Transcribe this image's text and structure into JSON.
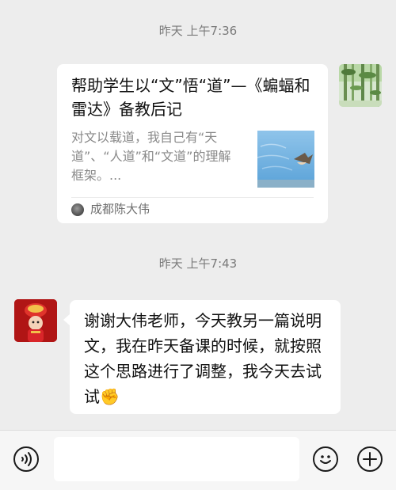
{
  "messages": {
    "timestamp_1": "昨天 上午7:36",
    "timestamp_2": "昨天 上午7:43",
    "link_card": {
      "title": "帮助学生以“文”悟“道”—《蝙蝠和雷达》备教后记",
      "description": "对文以载道，我自己有“天道”、“人道”和“文道”的理解框架。...",
      "source": "成都陈大伟"
    },
    "reply": {
      "text": "谢谢大伟老师，今天教另一篇说明文，我在昨天备课的时候，就按照这个思路进行了调整，我今天去试试✊"
    }
  },
  "icons": {
    "voice": "voice-icon",
    "emoji": "emoji-icon",
    "more": "plus-icon"
  }
}
